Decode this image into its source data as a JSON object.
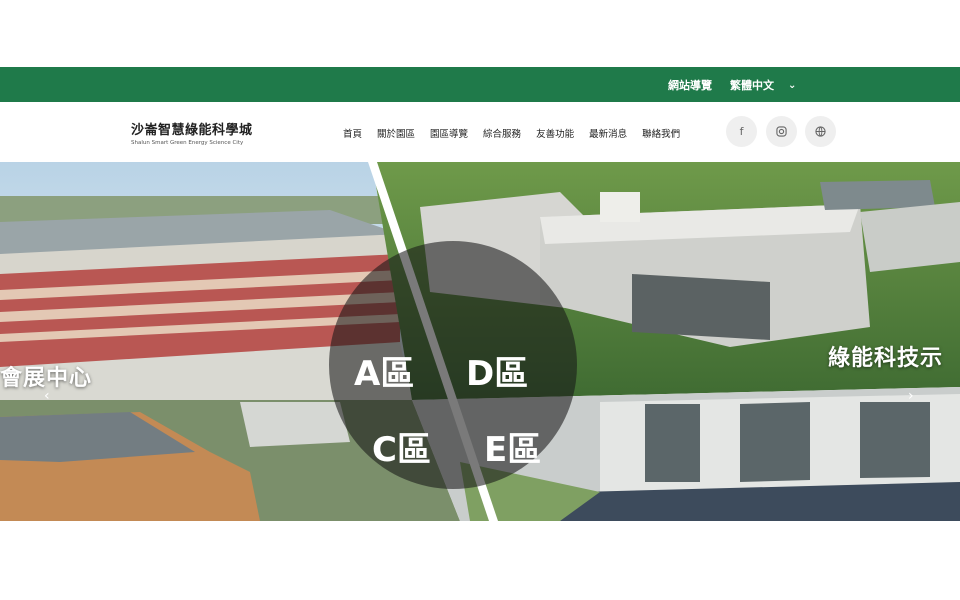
{
  "topbar": {
    "sitemap_label": "網站導覽",
    "language_label": "繁體中文",
    "chevron": "chevron-down-icon",
    "color": "#1f7a4a"
  },
  "logo": {
    "title_zh": "沙崙智慧綠能科學城",
    "title_en": "Shalun Smart Green Energy Science City"
  },
  "nav": {
    "items": [
      "首頁",
      "關於園區",
      "園區導覽",
      "綜合服務",
      "友善功能",
      "最新消息",
      "聯絡我們"
    ]
  },
  "social": [
    "facebook-icon",
    "instagram-icon",
    "globe-icon"
  ],
  "banner": {
    "caption_left": "會展中心",
    "caption_right": "綠能科技示",
    "zones": [
      "A區",
      "D區",
      "C區",
      "E區"
    ],
    "prev": "‹",
    "next": "›"
  }
}
